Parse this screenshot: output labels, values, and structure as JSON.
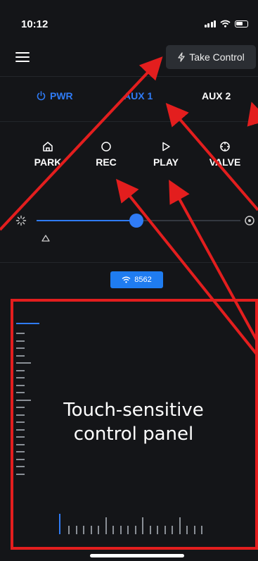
{
  "status_bar": {
    "time": "10:12"
  },
  "header": {
    "take_control_label": "Take Control"
  },
  "tabs": [
    {
      "label": "PWR",
      "color": "#2f7bf5"
    },
    {
      "label": "AUX 1",
      "color": "#2f7bf5"
    },
    {
      "label": "AUX 2",
      "color": "#ffffff"
    }
  ],
  "modes": [
    {
      "label": "PARK",
      "icon": "home-icon"
    },
    {
      "label": "REC",
      "icon": "circle-icon"
    },
    {
      "label": "PLAY",
      "icon": "play-icon"
    },
    {
      "label": "VALVE",
      "icon": "crosshair-icon"
    }
  ],
  "slider": {
    "value_fraction": 0.49,
    "left_icon": "spinner-icon",
    "right_icon": "target-icon",
    "marker_icon": "triangle-icon"
  },
  "connection": {
    "label": "8562",
    "icon": "wifi-icon"
  },
  "panel": {
    "label_line1": "Touch-sensitive",
    "label_line2": "control panel",
    "border_color": "#e31e1e"
  },
  "colors": {
    "accent": "#2f7bf5",
    "annotation": "#e31e1e",
    "background": "#141518"
  }
}
